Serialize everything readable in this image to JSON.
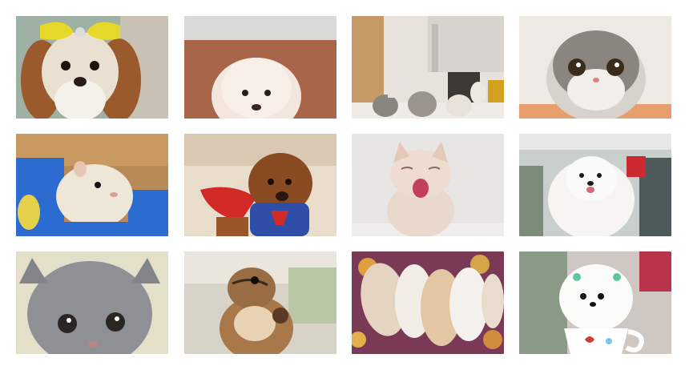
{
  "gallery": {
    "tiles": [
      {
        "subject": "shih-tzu-dog-with-yellow-bow"
      },
      {
        "subject": "white-poodle-puppy"
      },
      {
        "subject": "kittens-on-shelf",
        "watermark_text": ""
      },
      {
        "subject": "scottish-fold-kitten"
      },
      {
        "subject": "hamster-in-blue-cage"
      },
      {
        "subject": "teddy-poodle-superman-costume"
      },
      {
        "subject": "yawning-cream-kitten"
      },
      {
        "subject": "white-pomeranian-by-window"
      },
      {
        "subject": "grey-kitten-closeup"
      },
      {
        "subject": "chipmunk-eating"
      },
      {
        "subject": "sleeping-kittens-on-blanket"
      },
      {
        "subject": "white-pomeranian-in-teacup"
      }
    ],
    "colors": {
      "background": "#ffffff",
      "accent_yellow": "#e7d92a",
      "superman_blue": "#2f4ea8",
      "cape_red": "#d22a27",
      "cage_blue": "#2c6bd0"
    }
  }
}
